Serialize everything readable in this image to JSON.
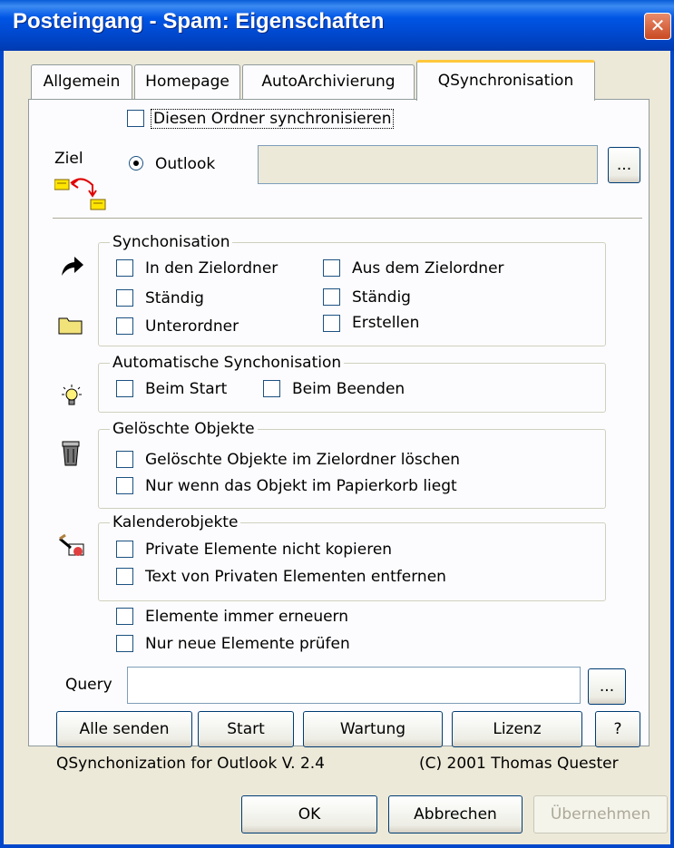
{
  "window": {
    "title": "Posteingang - Spam: Eigenschaften",
    "close_icon": "close-x-icon"
  },
  "tabs": [
    {
      "label": "Allgemein"
    },
    {
      "label": "Homepage"
    },
    {
      "label": "AutoArchivierung"
    },
    {
      "label": "QSynchronisation",
      "active": true
    }
  ],
  "sync_folder": {
    "label": "Diesen Ordner synchronisieren",
    "checked": false
  },
  "target": {
    "label": "Ziel",
    "radio_label": "Outlook",
    "radio_selected": true,
    "path_value": "",
    "browse_label": "..."
  },
  "synchronisation": {
    "legend": "Synchonisation",
    "to_target": "In den Zielordner",
    "from_target": "Aus dem Zielordner",
    "always_left": "Ständig",
    "always_right": "Ständig",
    "subfolders": "Unterordner",
    "create": "Erstellen"
  },
  "auto_sync": {
    "legend": "Automatische Synchonisation",
    "on_start": "Beim Start",
    "on_exit": "Beim Beenden"
  },
  "deleted": {
    "legend": "Gelöschte Objekte",
    "delete_in_target": "Gelöschte Objekte im Zielordner löschen",
    "only_if_trash": "Nur wenn das Objekt im Papierkorb liegt"
  },
  "calendar": {
    "legend": "Kalenderobjekte",
    "no_copy_private": "Private Elemente nicht kopieren",
    "remove_private_text": "Text von Privaten Elementen entfernen"
  },
  "always_renew": "Elemente immer erneuern",
  "check_new_only": "Nur neue Elemente prüfen",
  "query": {
    "label": "Query",
    "value": "",
    "browse_label": "..."
  },
  "actions": {
    "send_all": "Alle senden",
    "start": "Start",
    "maintenance": "Wartung",
    "license": "Lizenz",
    "help": "?"
  },
  "footer": {
    "version": "QSynchonization for Outlook V. 2.4",
    "copyright": "(C) 2001 Thomas Quester"
  },
  "dialog_buttons": {
    "ok": "OK",
    "cancel": "Abbrechen",
    "apply": "Übernehmen"
  },
  "colors": {
    "titlebar": "#0047CC",
    "dialog_bg": "#ECE9D8",
    "panel_bg": "#FCFCFE",
    "tab_highlight": "#FFC83C"
  }
}
